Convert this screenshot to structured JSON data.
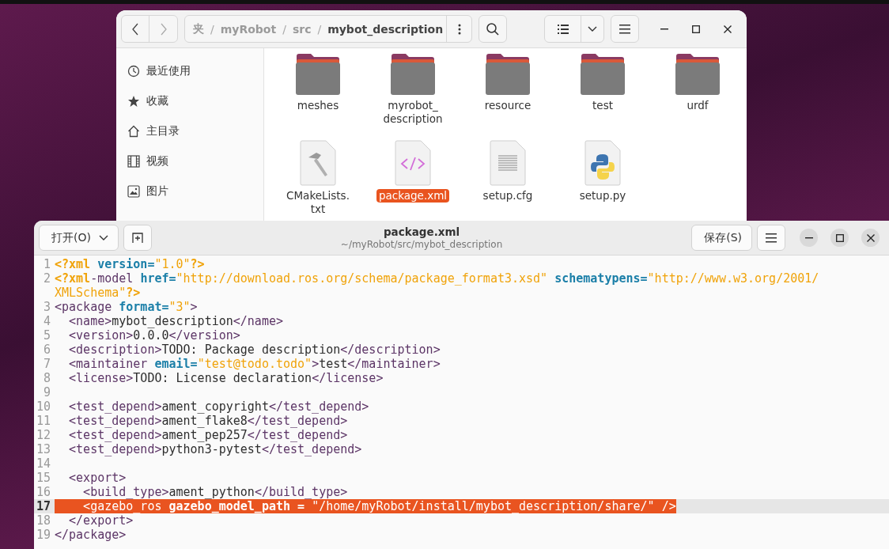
{
  "file_manager": {
    "path": [
      {
        "kind": "crumb",
        "text": "夹",
        "current": false
      },
      {
        "kind": "separator",
        "text": "/"
      },
      {
        "kind": "crumb",
        "text": "myRobot",
        "current": false
      },
      {
        "kind": "separator",
        "text": "/"
      },
      {
        "kind": "crumb",
        "text": "src",
        "current": false
      },
      {
        "kind": "separator",
        "text": "/"
      },
      {
        "kind": "crumb",
        "text": "mybot_description",
        "current": true
      }
    ],
    "sidebar": [
      {
        "label": "最近使用",
        "kind": "recent"
      },
      {
        "label": "收藏",
        "kind": "starred"
      },
      {
        "label": "主目录",
        "kind": "home"
      },
      {
        "label": "视频",
        "kind": "videos"
      },
      {
        "label": "图片",
        "kind": "pictures"
      }
    ],
    "files": [
      {
        "name": "meshes",
        "kind": "folder",
        "selected": false
      },
      {
        "name": "myrobot_ description",
        "kind": "folder",
        "selected": false
      },
      {
        "name": "resource",
        "kind": "folder",
        "selected": false
      },
      {
        "name": "test",
        "kind": "folder",
        "selected": false
      },
      {
        "name": "urdf",
        "kind": "folder",
        "selected": false
      },
      {
        "name": "CMakeLists. txt",
        "kind": "build",
        "selected": false
      },
      {
        "name": "package.xml",
        "kind": "code",
        "selected": true
      },
      {
        "name": "setup.cfg",
        "kind": "text",
        "selected": false
      },
      {
        "name": "setup.py",
        "kind": "python",
        "selected": false
      }
    ]
  },
  "editor": {
    "open_button": "打开(O)",
    "title": "package.xml",
    "subtitle": "~/myRobot/src/mybot_description",
    "save_button": "保存(S)",
    "lines": [
      {
        "number": "1",
        "current": false,
        "selected": false,
        "segments": [
          {
            "kind": "pi",
            "text": "<?xml"
          },
          {
            "kind": "attr",
            "text": " version="
          },
          {
            "kind": "str",
            "text": "\"1.0\""
          },
          {
            "kind": "pi",
            "text": "?>"
          }
        ]
      },
      {
        "number": "2",
        "current": false,
        "selected": false,
        "segments": [
          {
            "kind": "pi",
            "text": "<?xml"
          },
          {
            "kind": "tag",
            "text": "-model "
          },
          {
            "kind": "attr",
            "text": "href="
          },
          {
            "kind": "str",
            "text": "\"http://download.ros.org/schema/package_format3.xsd\""
          },
          {
            "kind": "attr",
            "text": " schematypens="
          },
          {
            "kind": "str",
            "text": "\"http://www.w3.org/2001/"
          }
        ],
        "wrapped": [
          {
            "kind": "str",
            "text": "XMLSchema\""
          },
          {
            "kind": "pi",
            "text": "?>"
          }
        ]
      },
      {
        "number": "3",
        "current": false,
        "selected": false,
        "segments": [
          {
            "kind": "tag",
            "text": "<package "
          },
          {
            "kind": "attr",
            "text": "format="
          },
          {
            "kind": "str",
            "text": "\"3\""
          },
          {
            "kind": "tag",
            "text": ">"
          }
        ]
      },
      {
        "number": "4",
        "current": false,
        "selected": false,
        "segments": [
          {
            "kind": "tag",
            "text": "  <name>"
          },
          {
            "kind": "text",
            "text": "mybot_description"
          },
          {
            "kind": "tag",
            "text": "</name>"
          }
        ]
      },
      {
        "number": "5",
        "current": false,
        "selected": false,
        "segments": [
          {
            "kind": "tag",
            "text": "  <version>"
          },
          {
            "kind": "text",
            "text": "0.0.0"
          },
          {
            "kind": "tag",
            "text": "</version>"
          }
        ]
      },
      {
        "number": "6",
        "current": false,
        "selected": false,
        "segments": [
          {
            "kind": "tag",
            "text": "  <description>"
          },
          {
            "kind": "text",
            "text": "TODO: Package description"
          },
          {
            "kind": "tag",
            "text": "</description>"
          }
        ]
      },
      {
        "number": "7",
        "current": false,
        "selected": false,
        "segments": [
          {
            "kind": "tag",
            "text": "  <maintainer "
          },
          {
            "kind": "attr",
            "text": "email="
          },
          {
            "kind": "str",
            "text": "\"test@todo.todo\""
          },
          {
            "kind": "tag",
            "text": ">"
          },
          {
            "kind": "text",
            "text": "test"
          },
          {
            "kind": "tag",
            "text": "</maintainer>"
          }
        ]
      },
      {
        "number": "8",
        "current": false,
        "selected": false,
        "segments": [
          {
            "kind": "tag",
            "text": "  <license>"
          },
          {
            "kind": "text",
            "text": "TODO: License declaration"
          },
          {
            "kind": "tag",
            "text": "</license>"
          }
        ]
      },
      {
        "number": "9",
        "current": false
      },
      {
        "number": "10",
        "current": false,
        "selected": false,
        "segments": [
          {
            "kind": "tag",
            "text": "  <test_depend>"
          },
          {
            "kind": "text",
            "text": "ament_copyright"
          },
          {
            "kind": "tag",
            "text": "</test_depend>"
          }
        ]
      },
      {
        "number": "11",
        "current": false,
        "selected": false,
        "segments": [
          {
            "kind": "tag",
            "text": "  <test_depend>"
          },
          {
            "kind": "text",
            "text": "ament_flake8"
          },
          {
            "kind": "tag",
            "text": "</test_depend>"
          }
        ]
      },
      {
        "number": "12",
        "current": false,
        "selected": false,
        "segments": [
          {
            "kind": "tag",
            "text": "  <test_depend>"
          },
          {
            "kind": "text",
            "text": "ament_pep257"
          },
          {
            "kind": "tag",
            "text": "</test_depend>"
          }
        ]
      },
      {
        "number": "13",
        "current": false,
        "selected": false,
        "segments": [
          {
            "kind": "tag",
            "text": "  <test_depend>"
          },
          {
            "kind": "text",
            "text": "python3-pytest"
          },
          {
            "kind": "tag",
            "text": "</test_depend>"
          }
        ]
      },
      {
        "number": "14",
        "current": false
      },
      {
        "number": "15",
        "current": false,
        "selected": false,
        "segments": [
          {
            "kind": "tag",
            "text": "  <export>"
          }
        ]
      },
      {
        "number": "16",
        "current": false,
        "selected": false,
        "segments": [
          {
            "kind": "tag",
            "text": "    <build_type>"
          },
          {
            "kind": "text",
            "text": "ament_python"
          },
          {
            "kind": "tag",
            "text": "</build_type>"
          }
        ]
      },
      {
        "number": "17",
        "current": true,
        "selected": true,
        "segments": [
          {
            "kind": "tag",
            "text": "    <gazebo_ros "
          },
          {
            "kind": "attr",
            "text": "gazebo_model_path = "
          },
          {
            "kind": "str",
            "text": "\"/home/myRobot/install/mybot_description/share/\""
          },
          {
            "kind": "tag",
            "text": " />"
          }
        ]
      },
      {
        "number": "18",
        "current": false,
        "selected": false,
        "segments": [
          {
            "kind": "tag",
            "text": "  </export>"
          }
        ]
      },
      {
        "number": "19",
        "current": false,
        "selected": false,
        "segments": [
          {
            "kind": "tag",
            "text": "</package>"
          }
        ]
      }
    ]
  }
}
